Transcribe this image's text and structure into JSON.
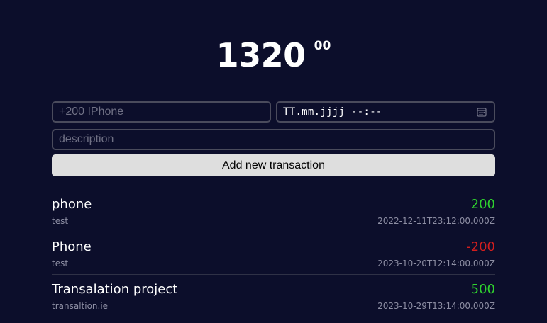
{
  "balance": {
    "main": "1320",
    "cents": "00"
  },
  "form": {
    "name_placeholder": "+200 IPhone",
    "date_placeholder": "TT.mm.jjjj --:--",
    "description_placeholder": "description",
    "add_button_label": "Add new transaction",
    "calendar_icon": "calendar-icon"
  },
  "colors": {
    "background": "#0c0e2b",
    "positive": "#2fd12f",
    "negative": "#d21e1e",
    "button": "#dedede"
  },
  "transactions": [
    {
      "name": "phone",
      "description": "test",
      "amount": "200",
      "sign": "positive",
      "datetime": "2022-12-11T23:12:00.000Z"
    },
    {
      "name": "Phone",
      "description": "test",
      "amount": "-200",
      "sign": "negative",
      "datetime": "2023-10-20T12:14:00.000Z"
    },
    {
      "name": "Transalation project",
      "description": "transaltion.ie",
      "amount": "500",
      "sign": "positive",
      "datetime": "2023-10-29T13:14:00.000Z"
    }
  ]
}
